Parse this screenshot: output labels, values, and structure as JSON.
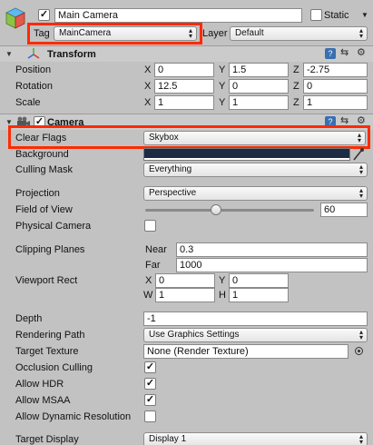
{
  "gameobject": {
    "name": "Main Camera",
    "static_label": "Static",
    "tag_label": "Tag",
    "tag_value": "MainCamera",
    "layer_label": "Layer",
    "layer_value": "Default"
  },
  "transform": {
    "title": "Transform",
    "axis": [
      "X",
      "Y",
      "Z"
    ],
    "position": {
      "label": "Position",
      "x": "0",
      "y": "1.5",
      "z": "-2.75"
    },
    "rotation": {
      "label": "Rotation",
      "x": "12.5",
      "y": "0",
      "z": "0"
    },
    "scale": {
      "label": "Scale",
      "x": "1",
      "y": "1",
      "z": "1"
    }
  },
  "camera": {
    "title": "Camera",
    "clear_flags": {
      "label": "Clear Flags",
      "value": "Skybox"
    },
    "background": {
      "label": "Background",
      "color": "#1c2a44"
    },
    "culling_mask": {
      "label": "Culling Mask",
      "value": "Everything"
    },
    "projection": {
      "label": "Projection",
      "value": "Perspective"
    },
    "fov": {
      "label": "Field of View",
      "value": "60",
      "fraction": 0.42
    },
    "physical_camera": {
      "label": "Physical Camera",
      "checked": false
    },
    "clipping": {
      "label": "Clipping Planes",
      "near_label": "Near",
      "near": "0.3",
      "far_label": "Far",
      "far": "1000"
    },
    "viewport": {
      "label": "Viewport Rect",
      "x_label": "X",
      "x": "0",
      "y_label": "Y",
      "y": "0",
      "w_label": "W",
      "w": "1",
      "h_label": "H",
      "h": "1"
    },
    "depth": {
      "label": "Depth",
      "value": "-1"
    },
    "rendering_path": {
      "label": "Rendering Path",
      "value": "Use Graphics Settings"
    },
    "target_texture": {
      "label": "Target Texture",
      "value": "None (Render Texture)"
    },
    "occlusion": {
      "label": "Occlusion Culling",
      "checked": true
    },
    "hdr": {
      "label": "Allow HDR",
      "checked": true
    },
    "msaa": {
      "label": "Allow MSAA",
      "checked": true
    },
    "dynres": {
      "label": "Allow Dynamic Resolution",
      "checked": false
    },
    "target_display": {
      "label": "Target Display",
      "value": "Display 1"
    }
  },
  "colors": {
    "highlight": "#ff2a00",
    "panel": "#c2c2c2"
  },
  "check_glyph": "✓"
}
